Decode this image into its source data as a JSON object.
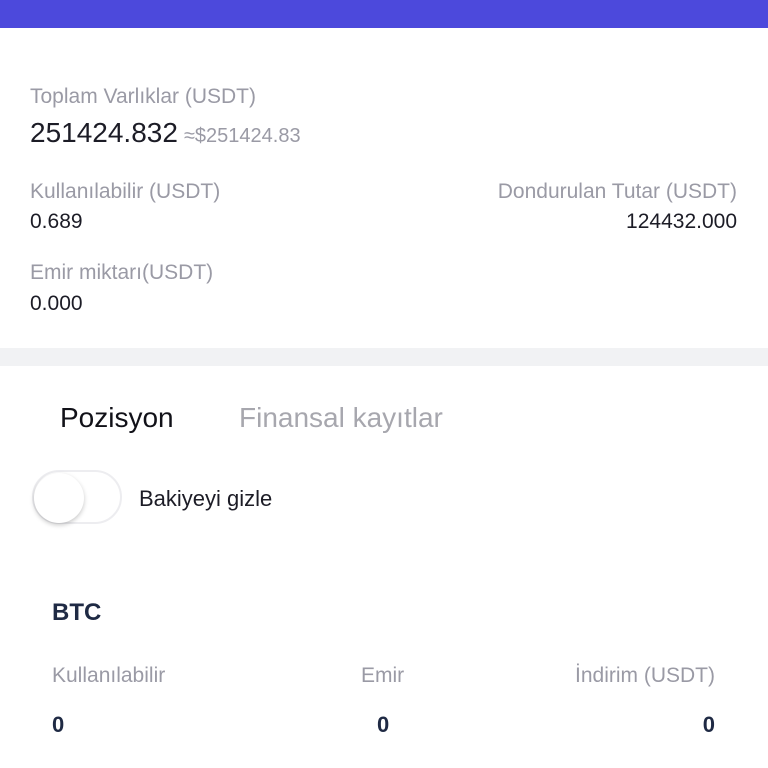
{
  "header": {
    "accent_color": "#4c49dc"
  },
  "summary": {
    "total_label": "Toplam Varlıklar (USDT)",
    "total_value": "251424.832",
    "total_approx": "≈$251424.83",
    "available_label": "Kullanılabilir (USDT)",
    "available_value": "0.689",
    "frozen_label": "Dondurulan Tutar (USDT)",
    "frozen_value": "124432.000",
    "order_label": "Emir miktarı(USDT)",
    "order_value": "0.000"
  },
  "tabs": [
    {
      "label": "Pozisyon",
      "active": true
    },
    {
      "label": "Finansal kayıtlar",
      "active": false
    }
  ],
  "hide_balance": {
    "label": "Bakiyeyi gizle",
    "enabled": false
  },
  "coin": {
    "title": "BTC",
    "columns": [
      {
        "label": "Kullanılabilir",
        "value": "0"
      },
      {
        "label": "Emir",
        "value": "0"
      },
      {
        "label": "İndirim (USDT)",
        "value": "0"
      }
    ]
  }
}
